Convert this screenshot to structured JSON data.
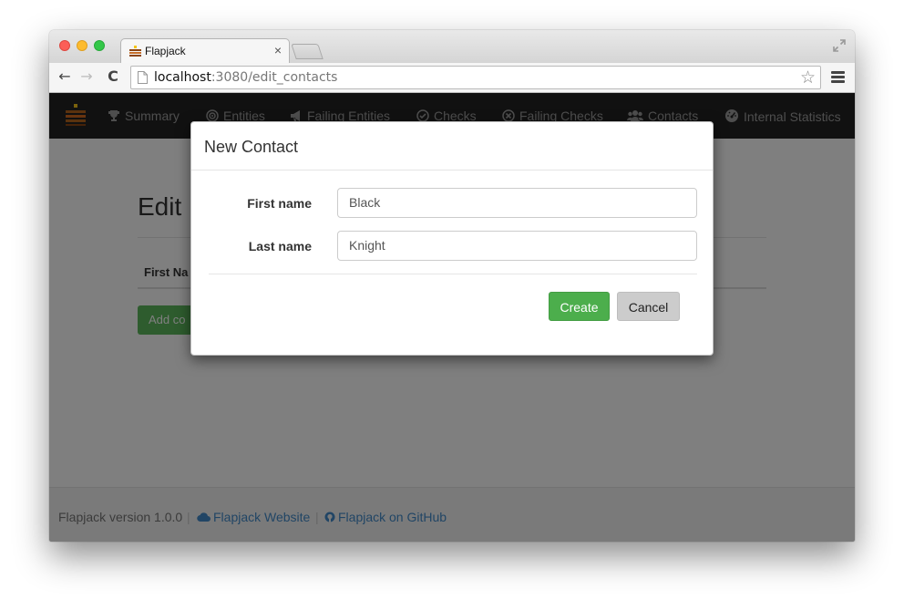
{
  "browser": {
    "tab_title": "Flapjack",
    "tab_close": "×",
    "url_host": "localhost",
    "url_rest": ":3080/edit_contacts",
    "back_glyph": "←",
    "forward_glyph": "→",
    "reload_glyph": "C",
    "star_glyph": "☆"
  },
  "navbar": {
    "items": [
      {
        "label": "Summary",
        "icon": "trophy-icon"
      },
      {
        "label": "Entities",
        "icon": "target-icon"
      },
      {
        "label": "Failing Entities",
        "icon": "bullhorn-icon"
      },
      {
        "label": "Checks",
        "icon": "check-circle-icon"
      },
      {
        "label": "Failing Checks",
        "icon": "x-circle-icon"
      },
      {
        "label": "Contacts",
        "icon": "users-icon"
      },
      {
        "label": "Internal Statistics",
        "icon": "dashboard-icon"
      }
    ]
  },
  "content": {
    "title": "Edit",
    "table_header": "First Na",
    "add_button": "Add co"
  },
  "footer": {
    "version": "Flapjack version 1.0.0",
    "separator": "|",
    "website_link": "Flapjack Website",
    "github_link": "Flapjack on GitHub"
  },
  "modal": {
    "title": "New Contact",
    "first_name_label": "First name",
    "first_name_value": "Black",
    "last_name_label": "Last name",
    "last_name_value": "Knight",
    "create_button": "Create",
    "cancel_button": "Cancel"
  },
  "colors": {
    "navbar_bg": "#222222",
    "success_green": "#5cb85c",
    "link_blue": "#428bca",
    "backdrop": "rgba(0,0,0,0.5)"
  }
}
